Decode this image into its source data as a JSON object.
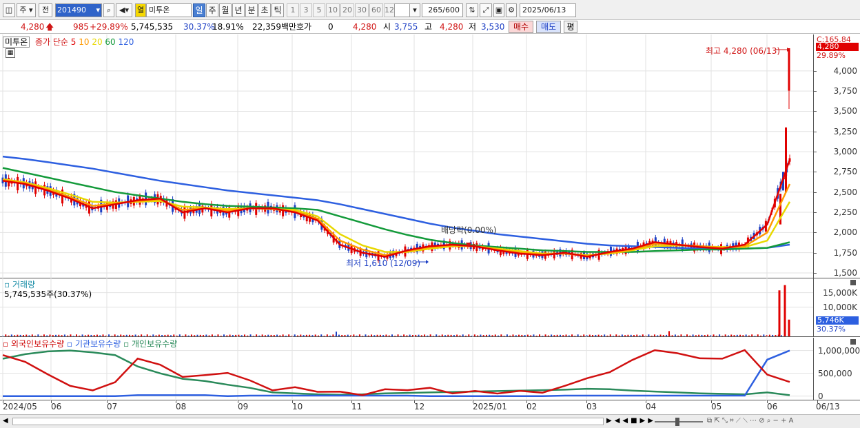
{
  "toolbar": {
    "market_mode": "주",
    "prev_label": "전",
    "stock_code": "201490",
    "stock_indicator": "열",
    "stock_name": "미투온",
    "period_tabs": [
      "일",
      "주",
      "월",
      "년",
      "분",
      "초",
      "틱"
    ],
    "active_period": "일",
    "interval_options": [
      "1",
      "3",
      "5",
      "10",
      "20",
      "30",
      "60",
      "120"
    ],
    "bar_count": "265",
    "bar_total": "/600",
    "date": "2025/06/13"
  },
  "quote": {
    "price": "4,280",
    "change": "985",
    "change_pct": "+29.89%",
    "volume": "5,745,535",
    "volume_pct": "30.37%",
    "turnover": "18.91%",
    "amount": "22,359백만",
    "hoga_label": "호가",
    "hoga_value": "0",
    "hoga_price": "4,280",
    "open_label": "시",
    "open": "3,755",
    "high_label": "고",
    "high": "4,280",
    "low_label": "저",
    "low": "3,530",
    "buy_label": "매수",
    "sell_label": "매도",
    "eval_label": "평"
  },
  "price_pane": {
    "name_tag": "미투온",
    "ma_label": "종가 단순",
    "ma_periods": [
      {
        "label": "5",
        "color": "#e00000"
      },
      {
        "label": "10",
        "color": "#ff9900"
      },
      {
        "label": "20",
        "color": "#e8d800"
      },
      {
        "label": "60",
        "color": "#139a3a"
      },
      {
        "label": "120",
        "color": "#2d5fe0"
      }
    ],
    "top_right_label": "C:165.84",
    "price_tag": "4,280",
    "pct_tag": "29.89%",
    "max_annotation": "최고 4,280 (06/13)",
    "min_annotation": "최저 1,610 (12/09)",
    "dividend_annotation": "배당락(0.00%)",
    "y_ticks": [
      "4,000",
      "3,750",
      "3,500",
      "3,250",
      "3,000",
      "2,750",
      "2,500",
      "2,250",
      "2,000",
      "1,750",
      "1,500"
    ]
  },
  "volume_pane": {
    "title": "거래량",
    "current_text": "5,745,535주(30.37%)",
    "y_ticks": [
      "15,000K",
      "10,000K"
    ],
    "volume_tag": "5,746K",
    "pct_tag": "30.37%"
  },
  "holding_pane": {
    "legend": [
      {
        "label": "외국인보유수량",
        "color": "#d01010"
      },
      {
        "label": "기관보유수량",
        "color": "#2d5fe0"
      },
      {
        "label": "개인보유수량",
        "color": "#2a8a5a"
      }
    ],
    "y_ticks": [
      "1,000,000",
      "500,000",
      "0"
    ]
  },
  "x_axis": {
    "labels": [
      "2024/05",
      "06",
      "07",
      "08",
      "09",
      "10",
      "11",
      "12",
      "2025/01",
      "02",
      "03",
      "04",
      "05",
      "06",
      "06/13"
    ]
  },
  "chart_data": [
    {
      "type": "candlestick",
      "title": "미투온",
      "x_range": [
        "2024/05",
        "2025/06/13"
      ],
      "ylim": [
        1500,
        4280
      ],
      "summary": {
        "last_close": 4280,
        "prev_close": 3295,
        "open": 3755,
        "high": 4280,
        "low": 3530,
        "period_high": 4280,
        "period_high_date": "06/13",
        "period_low": 1610,
        "period_low_date": "12/09"
      },
      "series": [
        {
          "name": "5",
          "values": [
            2640,
            2600,
            2520,
            2420,
            2300,
            2350,
            2400,
            2420,
            2250,
            2300,
            2250,
            2300,
            2300,
            2250,
            2150,
            1850,
            1750,
            1700,
            1780,
            1830,
            1850,
            1830,
            1780,
            1740,
            1720,
            1750,
            1700,
            1760,
            1800,
            1880,
            1850,
            1820,
            1800,
            1850,
            2100,
            2900
          ]
        },
        {
          "name": "10",
          "values": [
            2650,
            2610,
            2530,
            2440,
            2330,
            2360,
            2390,
            2410,
            2280,
            2300,
            2270,
            2300,
            2290,
            2260,
            2170,
            1900,
            1790,
            1720,
            1770,
            1820,
            1840,
            1830,
            1790,
            1750,
            1730,
            1740,
            1710,
            1750,
            1790,
            1860,
            1850,
            1830,
            1810,
            1830,
            2000,
            2600
          ]
        },
        {
          "name": "20",
          "values": [
            2660,
            2620,
            2550,
            2470,
            2380,
            2370,
            2380,
            2390,
            2320,
            2310,
            2290,
            2300,
            2290,
            2280,
            2200,
            1980,
            1840,
            1760,
            1760,
            1800,
            1830,
            1830,
            1800,
            1770,
            1740,
            1740,
            1720,
            1740,
            1780,
            1830,
            1840,
            1830,
            1820,
            1820,
            1900,
            2380
          ]
        },
        {
          "name": "60",
          "values": [
            2800,
            2740,
            2680,
            2620,
            2560,
            2500,
            2460,
            2420,
            2380,
            2350,
            2330,
            2320,
            2310,
            2300,
            2280,
            2200,
            2120,
            2040,
            1970,
            1910,
            1870,
            1840,
            1820,
            1800,
            1780,
            1770,
            1760,
            1760,
            1760,
            1770,
            1780,
            1790,
            1790,
            1800,
            1810,
            1880
          ]
        },
        {
          "name": "120",
          "values": [
            2940,
            2910,
            2870,
            2830,
            2790,
            2740,
            2690,
            2640,
            2600,
            2560,
            2520,
            2490,
            2460,
            2430,
            2400,
            2350,
            2290,
            2230,
            2170,
            2110,
            2060,
            2020,
            1980,
            1950,
            1920,
            1890,
            1860,
            1840,
            1830,
            1820,
            1810,
            1800,
            1800,
            1800,
            1810,
            1850
          ]
        }
      ]
    },
    {
      "type": "bar",
      "title": "거래량",
      "unit": "K",
      "ylim": [
        0,
        18000
      ],
      "last_value": 5746,
      "spikes": [
        {
          "date": "2025/06",
          "value": 15800
        },
        {
          "date": "2025/06",
          "value": 17600
        },
        {
          "date": "2025/06/13",
          "value": 5746
        }
      ]
    },
    {
      "type": "line",
      "ylim": [
        -50000,
        1100000
      ],
      "series": [
        {
          "name": "외국인보유수량",
          "values": [
            900000,
            750000,
            480000,
            220000,
            130000,
            300000,
            830000,
            680000,
            430000,
            450000,
            520000,
            330000,
            140000,
            180000,
            110000,
            80000,
            40000,
            130000,
            150000,
            160000,
            80000,
            90000,
            80000,
            90000,
            100000,
            200000,
            420000,
            500000,
            820000,
            980000,
            970000,
            800000,
            850000,
            980000,
            500000,
            280000
          ]
        },
        {
          "name": "기관보유수량",
          "values": [
            0,
            0,
            0,
            0,
            0,
            0,
            20000,
            20000,
            20000,
            20000,
            0,
            10000,
            10000,
            10000,
            10000,
            10000,
            10000,
            10000,
            10000,
            0,
            0,
            0,
            0,
            0,
            0,
            10000,
            10000,
            10000,
            10000,
            10000,
            10000,
            10000,
            10000,
            10000,
            800000,
            1000000
          ]
        },
        {
          "name": "개인보유수량",
          "values": [
            820000,
            920000,
            980000,
            1000000,
            960000,
            900000,
            650000,
            500000,
            380000,
            330000,
            250000,
            180000,
            80000,
            60000,
            40000,
            30000,
            40000,
            60000,
            70000,
            80000,
            90000,
            100000,
            110000,
            120000,
            130000,
            140000,
            160000,
            150000,
            120000,
            100000,
            80000,
            60000,
            50000,
            40000,
            80000,
            20000
          ]
        }
      ]
    }
  ]
}
